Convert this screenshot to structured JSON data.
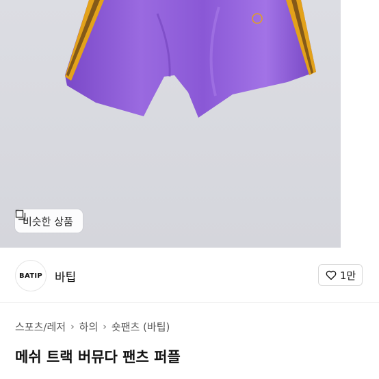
{
  "gallery": {
    "similar_button_label": "비슷한 상품",
    "similar_icon": "copy-icon"
  },
  "seller": {
    "avatar_text": "BATIP",
    "name": "바팁",
    "like_label": "1만",
    "like_icon": "heart-outline-icon"
  },
  "breadcrumb": {
    "items": [
      "스포츠/레저",
      "하의",
      "숏팬츠 (바팁)"
    ],
    "separator_icon": "chevron-right-icon"
  },
  "product": {
    "title": "메쉬 트랙 버뮤다 팬츠 퍼플"
  },
  "colors": {
    "photo_bg": "#d8d9df",
    "shorts": "#8f5fd8",
    "stripe": "#e3a21a"
  }
}
